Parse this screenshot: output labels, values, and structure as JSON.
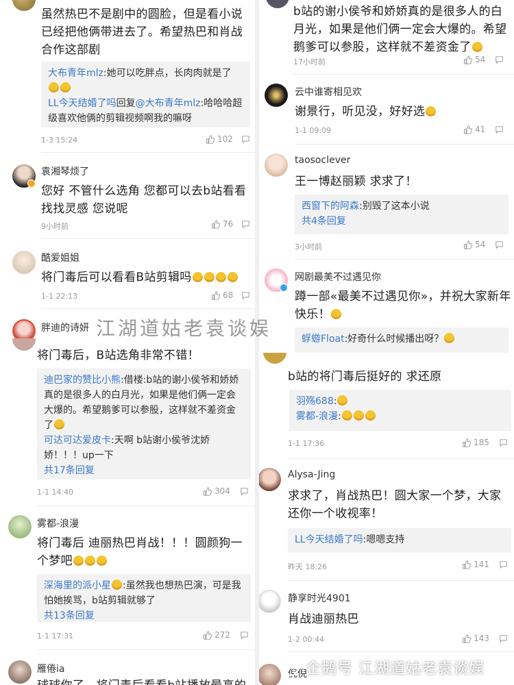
{
  "left": {
    "c1": {
      "text": "虽然热巴不是剧中的圆脸，但是看小说已经把他俩带进去了。希望热巴和肖战合作这部剧",
      "r1_name": "大布青年mlz",
      "r1_text": ":她可以吃胖点，长肉肉就是了",
      "r2_name": "LL今天结婚了吗",
      "r2_mid": "回复",
      "r2_target": "@大布青年mlz",
      "r2_text": ":哈哈哈超级喜欢他俩的剪辑视频啊我的嘛呀",
      "time": "1-3 15:24",
      "likes": "102"
    },
    "c2": {
      "user": "袁湘琴烦了",
      "text": "您好 不管什么选角 您都可以去b站看看 找找灵感 您说呢",
      "time": "9小时前",
      "likes": "76"
    },
    "c3": {
      "user": "酷爱姐姐",
      "text": "将门毒后可以看看B站剪辑吗",
      "time": "1-1 22:13",
      "likes": "68"
    },
    "c4": {
      "user": "胖迪的诗妍"
    },
    "c5": {
      "text": "将门毒后，B站选角非常不错！",
      "r1_name": "迪巴家的赞比小熊",
      "r1_text": ":借楼:b站的谢小侯爷和娇娇真的是很多人的白月光，如果是他们俩一定会大爆的。希望鹅爹可以参股，这样就不差资金了",
      "r2_name": "可达可达爱皮卡",
      "r2_text": ":天啊 b站谢小侯爷沈娇娇！！！up一下",
      "more": "共17条回复",
      "time": "1-1 14:40",
      "likes": "304"
    },
    "c6": {
      "user": "雾都-浪漫",
      "text": "将门毒后 迪丽热巴肖战！！！圆颜狗一个梦吧",
      "r1_name": "深海里的派小星",
      "r1_text": ":虽然我也想热巴演，可是我怕她挨骂，b站剪辑就够了",
      "more": "共13条回复",
      "time": "1-1 17:31",
      "likes": "272"
    },
    "c7": {
      "user": "雁倦ia",
      "text": "球球你了，将门毒后看看b站播放最高的"
    }
  },
  "right": {
    "c1": {
      "text": "b站的谢小侯爷和娇娇真的是很多人的白月光，如果是他们俩一定会大爆的。希望鹅爹可以参股，这样就不差资金了",
      "time": "17小时前",
      "likes": "54"
    },
    "c2": {
      "user": "云中谁寄相见欢",
      "text": "谢景行，听见没，好好选",
      "time": "1-1 09:09",
      "likes": "41"
    },
    "c3": {
      "user": "taosoclever",
      "text": "王一博赵丽颖 求求了！",
      "r1_name": "西窗下的阿森",
      "r1_text": ":别毁了这本小说",
      "more": "共4条回复",
      "time": "3小时前",
      "likes": "54"
    },
    "c4": {
      "user": "网剧最美不过遇见你",
      "text": "蹲一部«最美不过遇见你»，并祝大家新年快乐！",
      "r1_name": "蜉蝣Float",
      "r1_text": ":好奇什么时候播出呀？"
    },
    "c5": {
      "text": "b站的将门毒后挺好的 求还原",
      "r1_name": "羽殇688",
      "r1_text": ":",
      "r2_name": "雾都-浪漫",
      "r2_text": ":",
      "time": "1-1 17:36",
      "likes": "185"
    },
    "c6": {
      "user": "Alysa-Jing",
      "text": "求求了，肖战热巴！圆大家一个梦，大家还你一个收视率！",
      "r1_name": "LL今天结婚了吗",
      "r1_text": ":嗯嗯支持",
      "time": "昨天 18:26",
      "likes": "141"
    },
    "c7": {
      "user": "静享时光4901",
      "text": "肖战迪丽热巴",
      "time": "1-2 00:44",
      "likes": "143"
    },
    "c8": {
      "user": "倪倪"
    }
  },
  "watermark": {
    "main": "江湖道姑老袁谈娱",
    "footer": "企鹅号 江湖道姑老袁谈娱"
  },
  "colors": {
    "link": "#3b78c8",
    "reply_bg": "#f2f2f2",
    "meta": "#999999"
  },
  "icons": [
    "thumbs-up-icon",
    "comment-icon",
    "verified-badge-icon",
    "crying-emoji",
    "grin-emoji",
    "clap-emoji",
    "avatar"
  ]
}
